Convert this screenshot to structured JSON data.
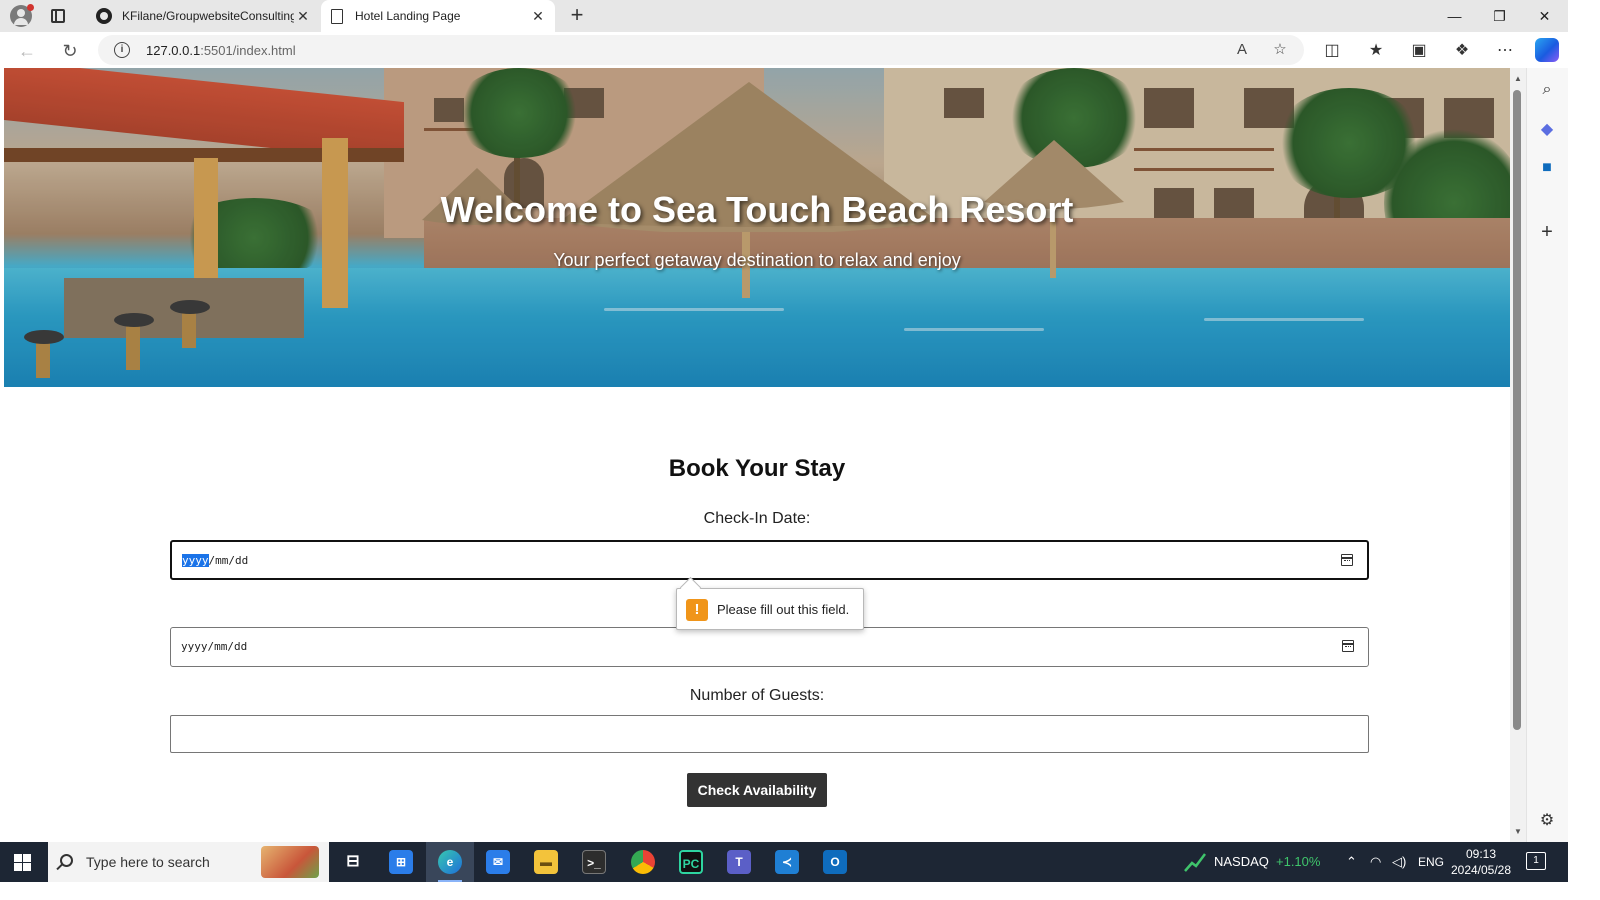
{
  "browser": {
    "tabs": [
      {
        "label": "KFilane/GroupwebsiteConsulting",
        "icon": "github-icon",
        "active": false
      },
      {
        "label": "Hotel Landing Page",
        "icon": "page-icon",
        "active": true
      }
    ],
    "address": {
      "host": "127.0.0.1",
      "rest": ":5501/index.html"
    },
    "accent": "#1a73e8"
  },
  "hero": {
    "title": "Welcome to Sea Touch Beach Resort",
    "subtitle": "Your perfect getaway destination to relax and enjoy"
  },
  "booking": {
    "title": "Book Your Stay",
    "checkin_label": "Check-In Date:",
    "date_placeholder": {
      "year": "yyyy",
      "month": "mm",
      "day": "dd"
    },
    "guests_label": "Number of Guests:",
    "submit_label": "Check Availability",
    "validation_message": "Please fill out this field.",
    "button_color": "#333333"
  },
  "taskbar": {
    "search_placeholder": "Type here to search",
    "ticker": {
      "name": "NASDAQ",
      "change": "+1.10%",
      "color": "#3fc46b"
    },
    "language": "ENG",
    "time": "09:13",
    "date": "2024/05/28",
    "notifications": "1"
  }
}
